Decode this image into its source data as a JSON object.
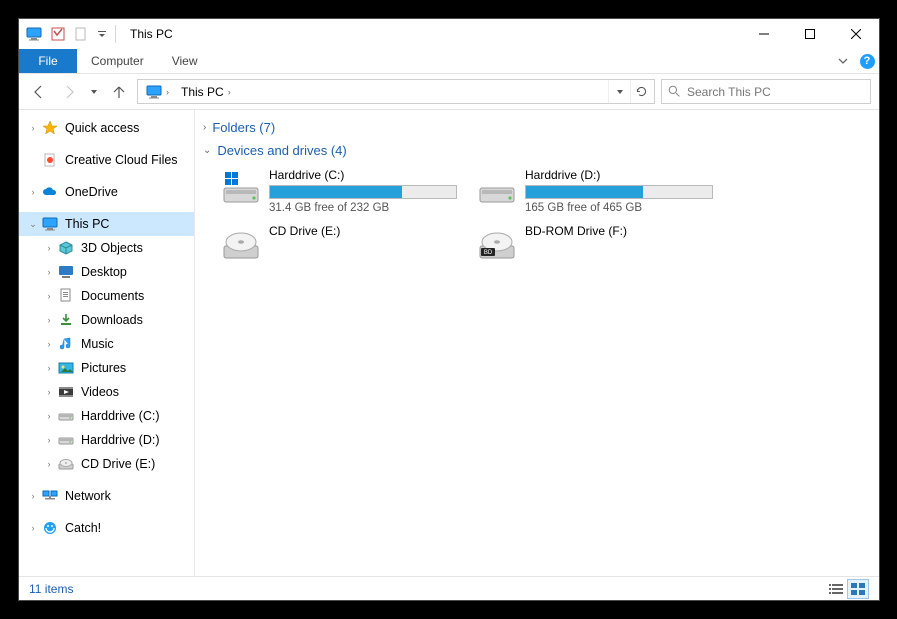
{
  "titlebar": {
    "title": "This PC"
  },
  "ribbon": {
    "file": "File",
    "tabs": [
      "Computer",
      "View"
    ]
  },
  "address": {
    "location": "This PC"
  },
  "search": {
    "placeholder": "Search This PC"
  },
  "sidebar": {
    "items": [
      {
        "label": "Quick access",
        "icon": "star",
        "caret": "right",
        "indent": 0
      },
      {
        "label": "Creative Cloud Files",
        "icon": "cloud-doc",
        "caret": "none",
        "indent": 0
      },
      {
        "label": "OneDrive",
        "icon": "cloud-blue",
        "caret": "right",
        "indent": 0
      },
      {
        "label": "This PC",
        "icon": "monitor",
        "caret": "down",
        "indent": 0,
        "selected": true
      },
      {
        "label": "3D Objects",
        "icon": "cube",
        "caret": "right",
        "indent": 1
      },
      {
        "label": "Desktop",
        "icon": "desktop",
        "caret": "right",
        "indent": 1
      },
      {
        "label": "Documents",
        "icon": "doc",
        "caret": "right",
        "indent": 1
      },
      {
        "label": "Downloads",
        "icon": "download",
        "caret": "right",
        "indent": 1
      },
      {
        "label": "Music",
        "icon": "music",
        "caret": "right",
        "indent": 1
      },
      {
        "label": "Pictures",
        "icon": "picture",
        "caret": "right",
        "indent": 1
      },
      {
        "label": "Videos",
        "icon": "video",
        "caret": "right",
        "indent": 1
      },
      {
        "label": "Harddrive (C:)",
        "icon": "drive",
        "caret": "right",
        "indent": 1
      },
      {
        "label": "Harddrive (D:)",
        "icon": "drive",
        "caret": "right",
        "indent": 1
      },
      {
        "label": "CD Drive (E:)",
        "icon": "disc",
        "caret": "right",
        "indent": 1
      },
      {
        "label": "Network",
        "icon": "network",
        "caret": "right",
        "indent": 0
      },
      {
        "label": "Catch!",
        "icon": "catch",
        "caret": "right",
        "indent": 0
      }
    ]
  },
  "content": {
    "groups": [
      {
        "title": "Folders (7)",
        "expanded": false
      },
      {
        "title": "Devices and drives (4)",
        "expanded": true
      }
    ],
    "drives": [
      {
        "name": "Harddrive (C:)",
        "sub": "31.4 GB free of 232 GB",
        "fillPct": 71,
        "icon": "drive-c"
      },
      {
        "name": "Harddrive (D:)",
        "sub": "165 GB free of 465 GB",
        "fillPct": 63,
        "icon": "drive"
      },
      {
        "name": "CD Drive (E:)",
        "sub": "",
        "fillPct": null,
        "icon": "disc"
      },
      {
        "name": "BD-ROM Drive (F:)",
        "sub": "",
        "fillPct": null,
        "icon": "bd"
      }
    ]
  },
  "status": {
    "text": "11 items"
  }
}
